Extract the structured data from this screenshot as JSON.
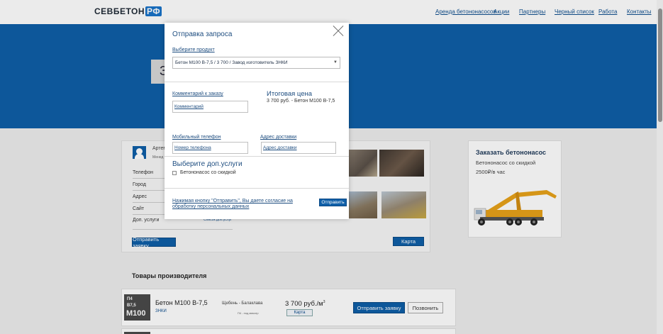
{
  "header": {
    "logo_main": "СЕВБЕТОН",
    "logo_suffix": "РФ",
    "nav": [
      "Аренда бетононасосов",
      "Акции",
      "Партнеры",
      "Черный список",
      "Работа",
      "Контакты"
    ]
  },
  "hero": {
    "partial_text": "З"
  },
  "seller": {
    "name": "Артем",
    "role": "Менед",
    "fields": [
      "Телефон",
      "Город",
      "Адрес",
      "Сайт",
      "Доп. услуги"
    ],
    "services_link": "Список доп.услуг",
    "send_button": "Отправить заявку",
    "map_button": "Карта"
  },
  "pump_card": {
    "title": "Заказать бетононасос",
    "subtitle": "Бетононасос со скидкой",
    "price": "2500₽/в час"
  },
  "products": {
    "section_title": "Товары производителя",
    "items": [
      {
        "thumb_lines": [
          "П4",
          "В7,5",
          "М100"
        ],
        "name": "Бетон М100 В-7,5",
        "maker": "ЗНКИ",
        "place": "Щебень - Балаклава",
        "note": "П4 - под миксер",
        "price": "3 700 руб./м",
        "price_unit_sup": "3",
        "map_label": "Карта",
        "send_label": "Отправить заявку",
        "call_label": "Позвонить"
      }
    ]
  },
  "modal": {
    "title": "Отправка запроса",
    "product_label": "Выберите продукт",
    "product_selected": "Бетон М100 В-7,5 / 3 700 / Завод изготовитель ЗНКИ",
    "comment_label": "Комментарий к заказу",
    "comment_placeholder": "Комментарий",
    "total_title": "Итоговая цена",
    "total_value": "3 700 руб. - Бетон М100 В-7,5",
    "phone_label": "Мобильный телефон",
    "phone_placeholder": "Номер телефона",
    "address_label": "Адрес доставки",
    "address_placeholder": "Адрес доставки",
    "extra_title": "Выберите доп.услуги",
    "extra_option": "Бетононасос со скидкой",
    "consent_text": "Нажимая кнопку \"Отправить\", Вы даете согласие на обработку персональных данных",
    "submit_label": "Отправить"
  }
}
